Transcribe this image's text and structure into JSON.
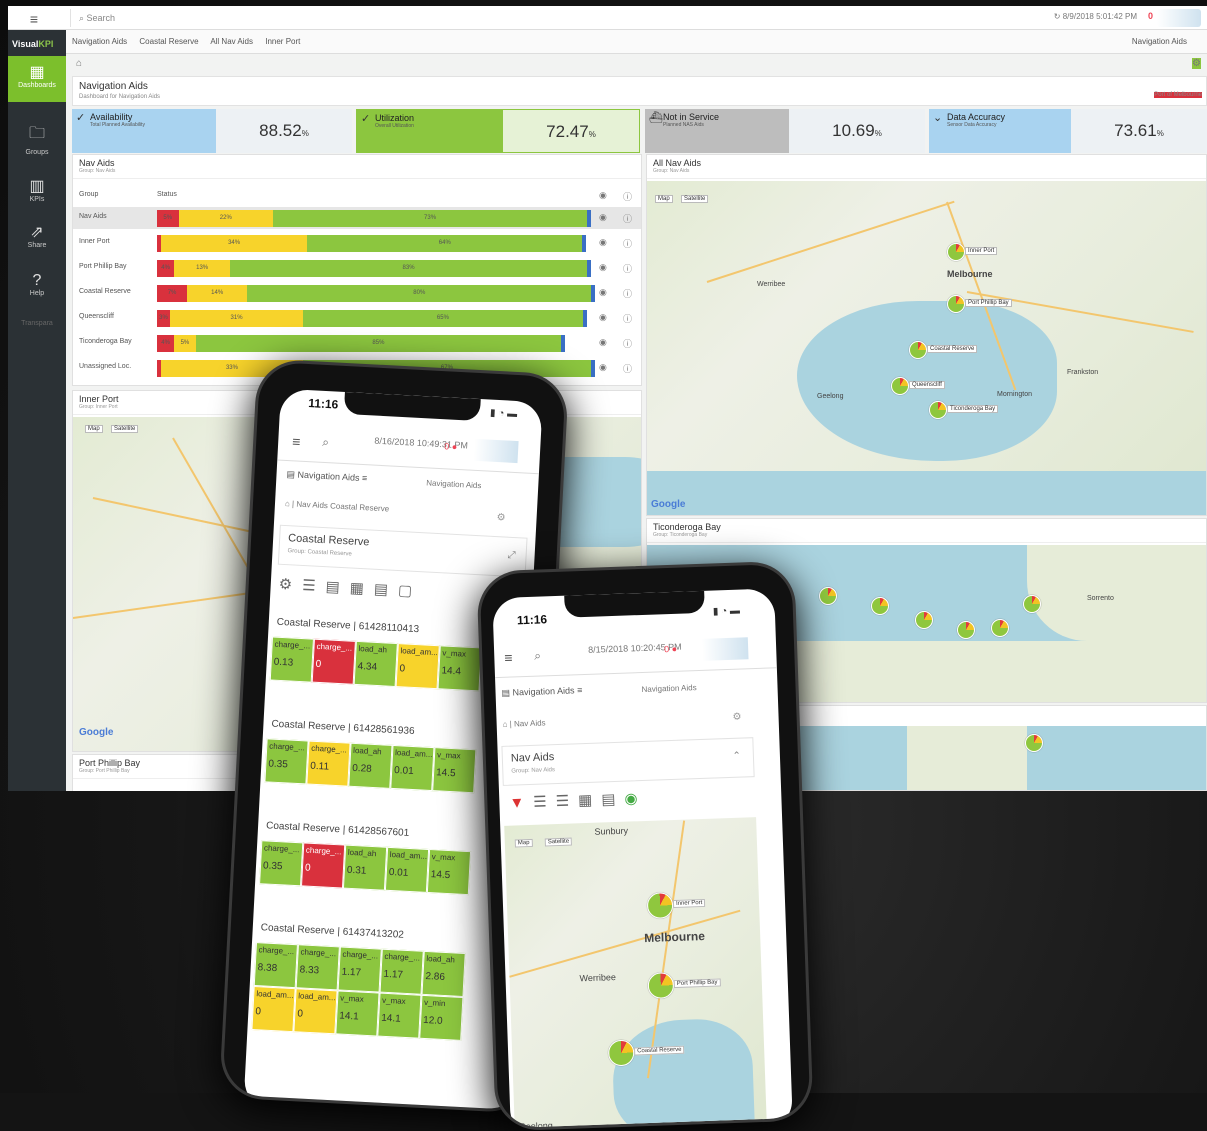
{
  "app": {
    "brand": "VisualKPI",
    "search_placeholder": "Search",
    "datetime": "8/9/2018 5:01:42 PM",
    "alert_count": "0",
    "nav": [
      {
        "label": "Dashboards",
        "icon": "dashboard-icon"
      },
      {
        "label": "Groups",
        "icon": "folder-icon"
      },
      {
        "label": "KPIs",
        "icon": "chart-icon"
      },
      {
        "label": "Share",
        "icon": "share-icon"
      },
      {
        "label": "Help",
        "icon": "help-icon"
      },
      {
        "label": "Transpara",
        "icon": "logo-icon"
      }
    ],
    "crumbs": [
      "Navigation Aids",
      "Coastal Reserve",
      "All Nav Aids",
      "Inner Port"
    ],
    "crumb_right": "Navigation Aids",
    "title": "Navigation Aids",
    "subtitle": "Dashboard for Navigation Aids",
    "title_right": "Port of Melbourne"
  },
  "kpis": [
    {
      "title": "Availability",
      "sub": "Total Planned Availability",
      "value": "88.52",
      "unit": "%",
      "color": "#a9d3f0"
    },
    {
      "title": "Utilization",
      "sub": "Overall Utilization",
      "value": "72.47",
      "unit": "%",
      "color": "#8cc63f"
    },
    {
      "title": "Not in Service",
      "sub": "Planned NAS Aids",
      "value": "10.69",
      "unit": "%",
      "color": "#bdbdbd"
    },
    {
      "title": "Data Accuracy",
      "sub": "Sensor Data Accuracy",
      "value": "73.61",
      "unit": "%",
      "color": "#a9d3f0"
    }
  ],
  "nav_aids": {
    "title": "Nav Aids",
    "sub": "Group: Nav Aids",
    "col_group": "Group",
    "col_status": "Status",
    "rows": [
      {
        "name": "Nav Aids",
        "r": "5%",
        "y": "22%",
        "g": "73%"
      },
      {
        "name": "Inner Port",
        "r": "",
        "y": "34%",
        "g": "64%"
      },
      {
        "name": "Port Phillip Bay",
        "r": "4%",
        "y": "13%",
        "g": "83%"
      },
      {
        "name": "Coastal Reserve",
        "r": "7%",
        "y": "14%",
        "g": "80%"
      },
      {
        "name": "Queenscliff",
        "r": "3%",
        "y": "31%",
        "g": "65%"
      },
      {
        "name": "Ticonderoga Bay",
        "r": "4%",
        "y": "5%",
        "g": "85%"
      },
      {
        "name": "Unassigned Loc.",
        "r": "",
        "y": "33%",
        "g": "67%"
      }
    ]
  },
  "inner_port": {
    "title": "Inner Port",
    "sub": "Group: Inner Port"
  },
  "port_phillip": {
    "title": "Port Phillip Bay",
    "sub": "Group: Port Phillip Bay"
  },
  "all_nav": {
    "title": "All Nav Aids",
    "sub": "Group: Nav Aids",
    "map_btn": "Map",
    "sat_btn": "Satellite",
    "places": [
      "Melbourne",
      "Geelong",
      "Frankston",
      "Mornington",
      "Werribee"
    ],
    "pins": [
      "Inner Port",
      "Port Phillip Bay",
      "Coastal Reserve",
      "Queenscliff",
      "Ticonderoga Bay"
    ],
    "google": "Google"
  },
  "ticonderoga": {
    "title": "Ticonderoga Bay",
    "sub": "Group: Ticonderoga Bay",
    "place": "Sorrento"
  },
  "phone1": {
    "time": "11:16",
    "datetime": "8/16/2018 10:49:31 PM",
    "nav_label": "Navigation Aids",
    "breadcrumb": "Nav Aids  Coastal Reserve",
    "panel_title": "Coastal Reserve",
    "panel_sub": "Group: Coastal Reserve",
    "sections": [
      {
        "title": "Coastal Reserve | 61428110413",
        "cells": [
          [
            "charge_...",
            "0.13",
            "g"
          ],
          [
            "charge_...",
            "0",
            "r"
          ],
          [
            "load_ah",
            "4.34",
            "g"
          ],
          [
            "load_am...",
            "0",
            "y"
          ],
          [
            "v_max",
            "14.4",
            "g"
          ]
        ]
      },
      {
        "title": "Coastal Reserve | 61428561936",
        "cells": [
          [
            "charge_...",
            "0.35",
            "g"
          ],
          [
            "charge_...",
            "0.11",
            "y"
          ],
          [
            "load_ah",
            "0.28",
            "g"
          ],
          [
            "load_am...",
            "0.01",
            "g"
          ],
          [
            "v_max",
            "14.5",
            "g"
          ]
        ]
      },
      {
        "title": "Coastal Reserve | 61428567601",
        "cells": [
          [
            "charge_...",
            "0.35",
            "g"
          ],
          [
            "charge_...",
            "0",
            "r"
          ],
          [
            "load_ah",
            "0.31",
            "g"
          ],
          [
            "load_am...",
            "0.01",
            "g"
          ],
          [
            "v_max",
            "14.5",
            "g"
          ]
        ]
      },
      {
        "title": "Coastal Reserve | 61437413202",
        "cells": [
          [
            "charge_...",
            "8.38",
            "g"
          ],
          [
            "charge_...",
            "8.33",
            "g"
          ],
          [
            "charge_...",
            "1.17",
            "g"
          ],
          [
            "charge_...",
            "1.17",
            "g"
          ],
          [
            "load_ah",
            "2.86",
            "g"
          ]
        ]
      }
    ],
    "extra_cells": [
      [
        "load_am...",
        "0",
        "y"
      ],
      [
        "load_am...",
        "0",
        "y"
      ],
      [
        "v_max",
        "14.1",
        "g"
      ],
      [
        "v_max",
        "14.1",
        "g"
      ],
      [
        "v_min",
        "12.0",
        "g"
      ]
    ]
  },
  "phone2": {
    "time": "11:16",
    "datetime": "8/15/2018 10:20:45 PM",
    "nav_label": "Navigation Aids",
    "breadcrumb": "Nav Aids",
    "panel_title": "Nav Aids",
    "panel_sub": "Group: Nav Aids",
    "map_btn": "Map",
    "sat_btn": "Satellite",
    "places": [
      "Melbourne",
      "Werribee",
      "Sunbury",
      "Geelong"
    ],
    "pins": [
      "Inner Port",
      "Port Phillip Bay",
      "Coastal Reserve"
    ]
  }
}
